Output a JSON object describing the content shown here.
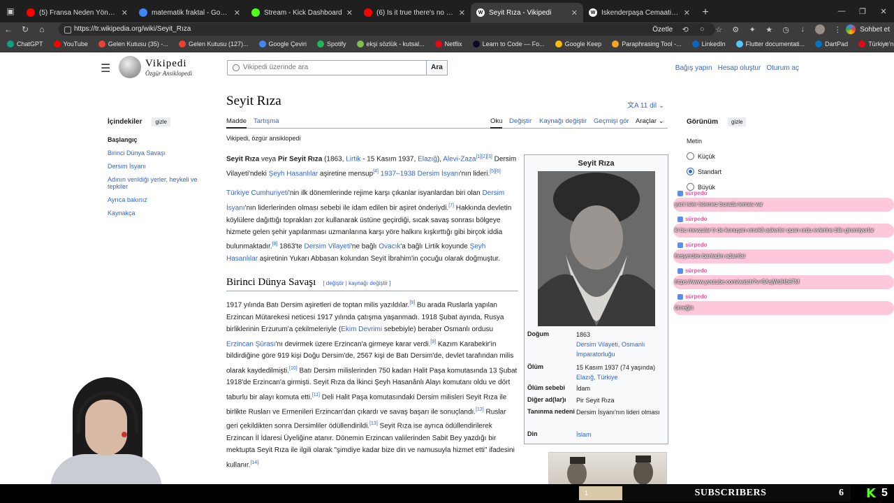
{
  "browser": {
    "tabs": [
      {
        "label": "(5) Fransa Neden Yönetilemiyor?",
        "color": "#ff0000",
        "active": false
      },
      {
        "label": "matematik fraktal - Google'da Ara",
        "color": "#4285f4",
        "active": false
      },
      {
        "label": "Stream - Kick Dashboard",
        "color": "#53fc18",
        "active": false
      },
      {
        "label": "(6) Is it true there's no document",
        "color": "#ff0000",
        "active": false
      },
      {
        "label": "Seyit Rıza - Vikipedi",
        "color": "#ffffff",
        "active": true
      },
      {
        "label": "İskenderpaşa Cemaati - Vikipedi",
        "color": "#ffffff",
        "active": false
      }
    ],
    "url": "https://tr.wikipedia.org/wiki/Seyit_Rıza",
    "summarize_label": "Özetle",
    "chat_label": "Sohbet et",
    "bookmarks": [
      {
        "label": "ChatGPT",
        "color": "#10a37f"
      },
      {
        "label": "YouTube",
        "color": "#ff0000"
      },
      {
        "label": "Gelen Kutusu (35) -...",
        "color": "#ea4335"
      },
      {
        "label": "Gelen Kutusu (127)...",
        "color": "#ea4335"
      },
      {
        "label": "Google Çeviri",
        "color": "#4285f4"
      },
      {
        "label": "Spotify",
        "color": "#1db954"
      },
      {
        "label": "ekşi sözlük - kutsal...",
        "color": "#81c14b"
      },
      {
        "label": "Netflix",
        "color": "#e50914"
      },
      {
        "label": "Learn to Code — Fo...",
        "color": "#0a0a23"
      },
      {
        "label": "Google Keep",
        "color": "#fbbc04"
      },
      {
        "label": "Paraphrasing Tool -...",
        "color": "#f5a623"
      },
      {
        "label": "LinkedIn",
        "color": "#0a66c2"
      },
      {
        "label": "Flutter documentati...",
        "color": "#54c5f8"
      },
      {
        "label": "DartPad",
        "color": "#0175c2"
      },
      {
        "label": "Türkiye'nin En Büyü...",
        "color": "#e30a17"
      }
    ]
  },
  "wiki": {
    "logo_name": "Vikipedi",
    "logo_sub": "Özgür Ansiklopedi",
    "search_placeholder": "Vikipedi üzerinde ara",
    "search_button": "Ara",
    "user_links": [
      "Bağış yapın",
      "Hesap oluştur",
      "Oturum aç"
    ],
    "toc_title": "İçindekiler",
    "hide_label": "gizle",
    "toc": [
      "Başlangıç",
      "Birinci Dünya Savaşı",
      "Dersim İsyanı",
      "Adının verildiği yerler, heykeli ve tepkiler",
      "Ayrıca bakınız",
      "Kaynakça"
    ],
    "title": "Seyit Rıza",
    "langs": "11 dil",
    "tab_article": "Madde",
    "tab_talk": "Tartışma",
    "tab_read": "Oku",
    "tab_edit": "Değiştir",
    "tab_source": "Kaynağı değiştir",
    "tab_history": "Geçmişi gör",
    "tab_tools": "Araçlar",
    "tagline": "Vikipedi, özgür ansiklopedi",
    "h2_ww1": "Birinci Dünya Savaşı",
    "edit_links": "[ değiştir | kaynağı değiştir ]",
    "appearance_title": "Görünüm",
    "text_label": "Metin",
    "sizes": [
      "Küçük",
      "Standart",
      "Büyük"
    ],
    "infobox": {
      "title": "Seyit Rıza",
      "rows": [
        {
          "k": "Doğum",
          "v": "1863",
          "v2": "Dersim Vilayeti, Osmanlı İmparatorluğu"
        },
        {
          "k": "Ölüm",
          "v": "15 Kasım 1937 (74 yaşında)",
          "v2": "Elazığ, Türkiye"
        },
        {
          "k": "Ölüm sebebi",
          "v": "İdam"
        },
        {
          "k": "Diğer ad(lar)ı",
          "v": "Pir Seyit Rıza"
        },
        {
          "k": "Tanınma nedeni",
          "v": "Dersim İsyanı'nın lideri olması"
        },
        {
          "k": "Din",
          "v": "İslam"
        }
      ]
    }
  },
  "chat": [
    {
      "user": "sürpedo",
      "text": "yani ister istemez burada temas var"
    },
    {
      "user": "sürpedo",
      "text": "ki bu mevzular tr de konuşan emekli askerler quan ordu evlerine bile giremiyorlar"
    },
    {
      "user": "sürpedo",
      "text": "hesyerden banladın adamlar"
    },
    {
      "user": "sürpedo",
      "text": "https://www.youtube.com/watch?v=5AsjWdHb67M"
    },
    {
      "user": "sürpedo",
      "text": "örneğin"
    }
  ],
  "stream": {
    "sub_progress": "1",
    "sub_label": "SUBSCRIBERS",
    "sub_count": "6",
    "kick_num": "5"
  }
}
